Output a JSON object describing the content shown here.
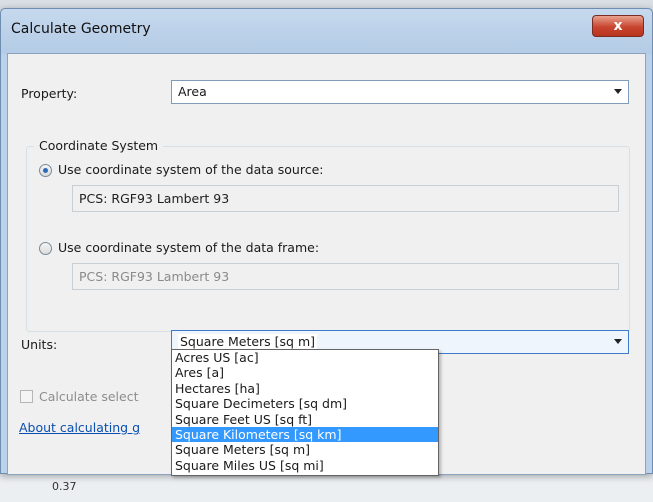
{
  "window": {
    "title": "Calculate Geometry",
    "close_glyph": "x"
  },
  "property": {
    "label": "Property:",
    "value": "Area"
  },
  "coordinate_system": {
    "group_title": "Coordinate System",
    "data_source_label": "Use coordinate system of the data source:",
    "data_source_value": "PCS: RGF93 Lambert 93",
    "data_frame_label": "Use coordinate system of the data frame:",
    "data_frame_value": "PCS: RGF93 Lambert 93",
    "selected": "data_source"
  },
  "units": {
    "label": "Units:",
    "value": "Square Meters [sq m]",
    "options": [
      "Acres US [ac]",
      "Ares [a]",
      "Hectares [ha]",
      "Square Decimeters [sq dm]",
      "Square Feet US [sq ft]",
      "Square Kilometers [sq km]",
      "Square Meters [sq m]",
      "Square Miles US [sq mi]"
    ],
    "highlighted": "Square Kilometers [sq km]"
  },
  "calculate_selected": {
    "label": "Calculate select",
    "checked": false
  },
  "help_link": "About calculating g",
  "background_cells": [
    "0.37"
  ],
  "colors": {
    "highlight": "#3399ff",
    "link": "#0a4fb0",
    "close_button": "#c8452f"
  }
}
